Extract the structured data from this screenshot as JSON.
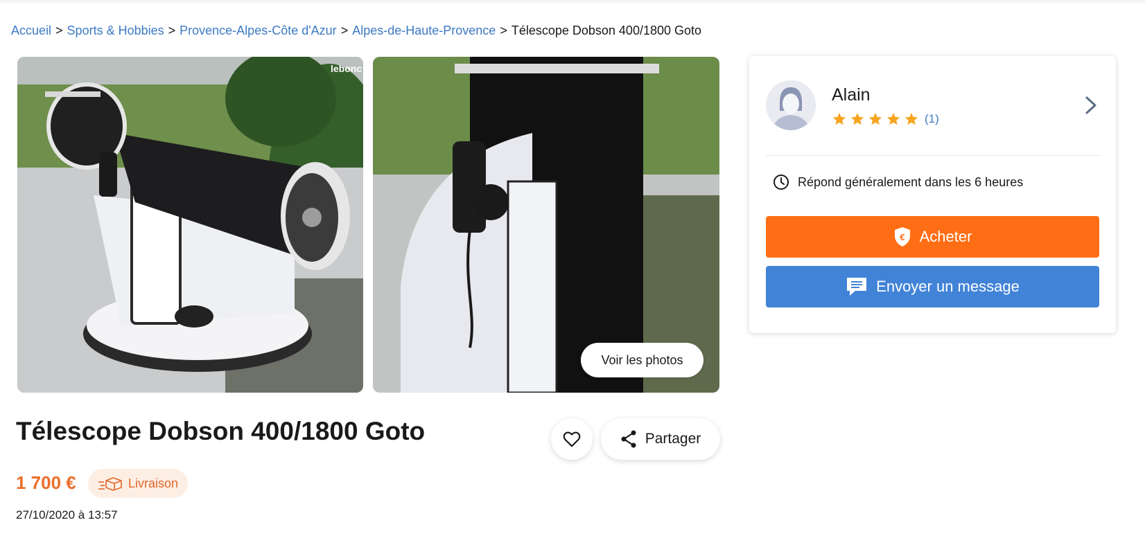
{
  "breadcrumb": {
    "items": [
      "Accueil",
      "Sports & Hobbies",
      "Provence-Alpes-Côte d'Azur",
      "Alpes-de-Haute-Provence"
    ],
    "separator": ">",
    "current": "Télescope Dobson 400/1800 Goto"
  },
  "gallery": {
    "watermark": "lebonc",
    "see_photos_label": "Voir les photos"
  },
  "listing": {
    "title": "Télescope Dobson 400/1800 Goto",
    "price": "1 700 €",
    "delivery_label": "Livraison",
    "date": "27/10/2020 à 13:57",
    "share_label": "Partager"
  },
  "seller": {
    "name": "Alain",
    "rating": 5,
    "rating_max": 5,
    "review_count": "(1)",
    "response_time": "Répond généralement dans les 6 heures",
    "buy_label": "Acheter",
    "message_label": "Envoyer un message"
  },
  "colors": {
    "link": "#3d7ac4",
    "price": "#ec6f2b",
    "buy_button": "#ff6e14",
    "message_button": "#4183d7",
    "star": "#f7a520"
  },
  "icons": {
    "heart": "heart-icon",
    "share": "share-icon",
    "delivery": "delivery-box-icon",
    "clock": "clock-icon",
    "euro_shield": "euro-shield-icon",
    "message": "message-bubble-icon",
    "chevron": "chevron-right-icon"
  }
}
